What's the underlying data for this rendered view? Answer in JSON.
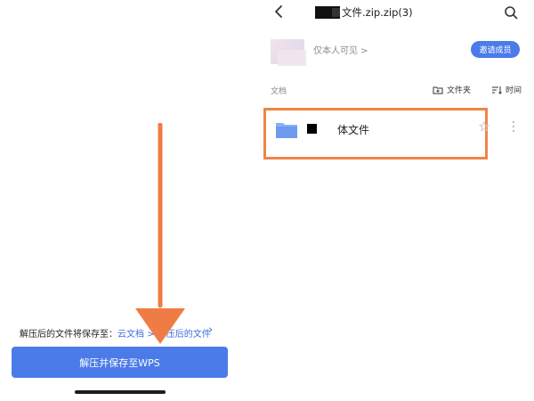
{
  "left": {
    "save_hint_prefix": "解压后的文件将保存至：",
    "save_hint_path": "云文档 > 解压后的文件",
    "primary_button": "解压并保存至WPS"
  },
  "right": {
    "header": {
      "title": "文件.zip.zip(3)",
      "back_icon": "chevron-left-icon",
      "search_icon": "search-icon"
    },
    "owner": {
      "visibility_text": "仅本人可见 >",
      "invite_button": "邀请成员"
    },
    "list": {
      "section_label": "文档",
      "new_folder_label": "文件夹",
      "sort_label": "时间",
      "items": [
        {
          "name": "体文件",
          "icon": "folder-icon"
        }
      ]
    }
  },
  "overlay": {
    "highlight_color": "#ef8547",
    "arrow_color": "#f07c45"
  },
  "theme": {
    "accent": "#4b7be8"
  }
}
